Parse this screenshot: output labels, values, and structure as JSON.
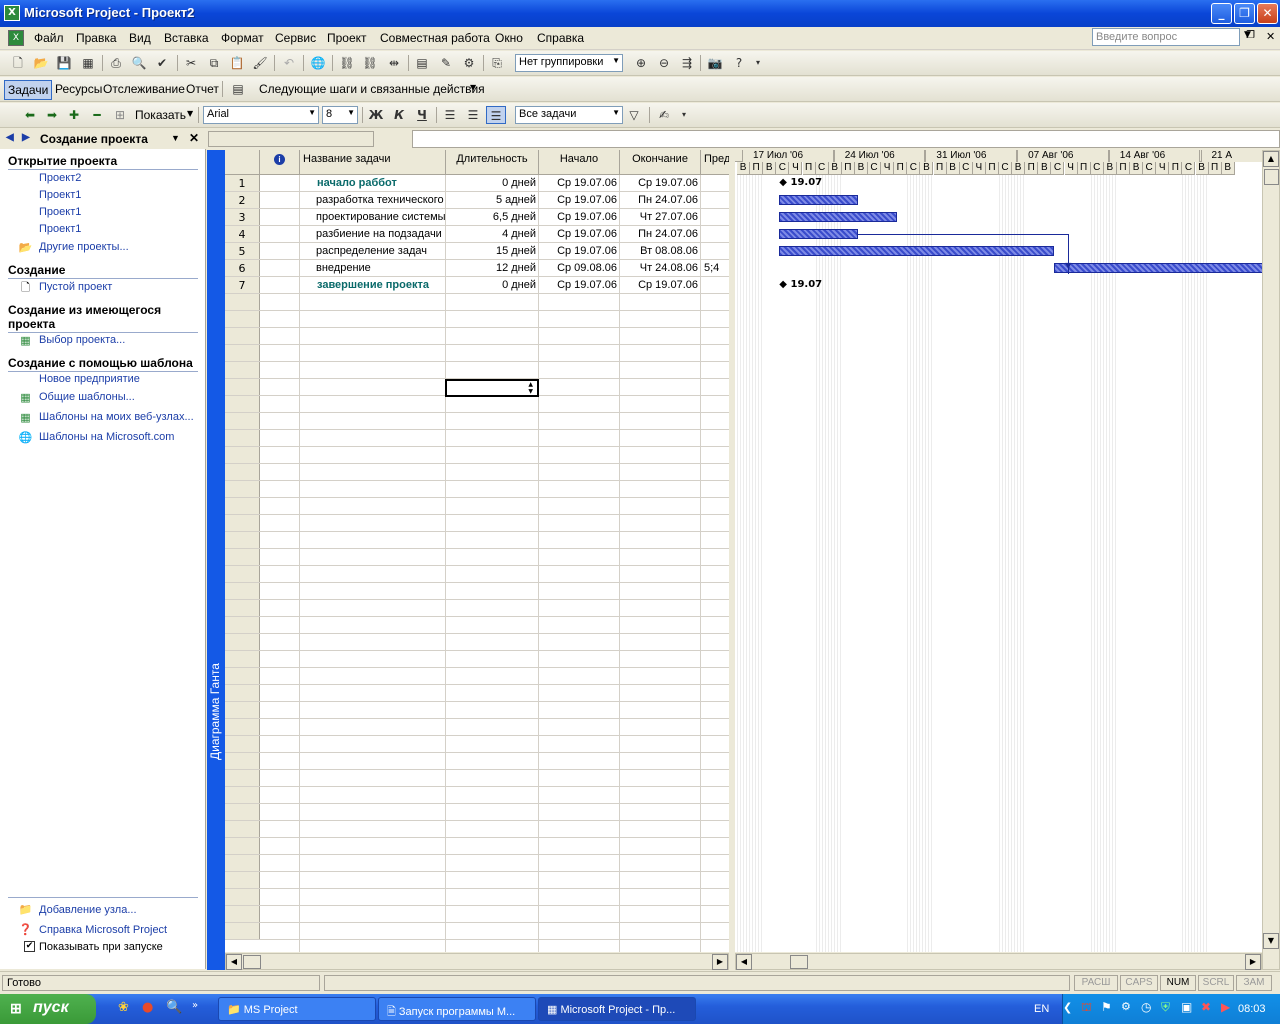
{
  "window": {
    "title": "Microsoft Project - Проект2",
    "app_icon": "X"
  },
  "menu": {
    "items": [
      "Файл",
      "Правка",
      "Вид",
      "Вставка",
      "Формат",
      "Сервис",
      "Проект",
      "Совместная работа",
      "Окно",
      "Справка"
    ],
    "ask_placeholder": "Введите вопрос"
  },
  "toolbar_standard": {
    "grouping": "Нет группировки"
  },
  "toolbar_guide": {
    "tabs": [
      "Задачи",
      "Ресурсы",
      "Отслеживание",
      "Отчет"
    ],
    "next_steps": "Следующие шаги и связанные действия"
  },
  "toolbar_format": {
    "show_label": "Показать",
    "font": "Arial",
    "size": "8",
    "bold": "Ж",
    "italic": "К",
    "underline": "Ч",
    "filter": "Все задачи"
  },
  "taskpane": {
    "title": "Создание проекта",
    "sections": {
      "open": {
        "title": "Открытие проекта",
        "links": [
          "Проект2",
          "Проект1",
          "Проект1",
          "Проект1"
        ],
        "other": "Другие проекты..."
      },
      "create": {
        "title": "Создание",
        "blank": "Пустой проект"
      },
      "existing": {
        "title": "Создание из имеющегося проекта",
        "choose": "Выбор проекта..."
      },
      "template": {
        "title": "Создание с помощью шаблона",
        "links": [
          "Новое предприятие",
          "Общие шаблоны...",
          "Шаблоны на моих веб-узлах...",
          "Шаблоны на Microsoft.com"
        ]
      }
    },
    "footer": {
      "add_node": "Добавление узла...",
      "help": "Справка Microsoft Project",
      "show_startup": "Показывать при запуске"
    }
  },
  "view_label": "Диаграмма Ганта",
  "table": {
    "headers": [
      "Название задачи",
      "Длительность",
      "Начало",
      "Окончание",
      "Пред"
    ],
    "info_icon": "i",
    "rows": [
      {
        "id": "1",
        "name": "начало раббот",
        "duration": "0 дней",
        "start": "Ср 19.07.06",
        "finish": "Ср 19.07.06",
        "pred": "",
        "summary": true
      },
      {
        "id": "2",
        "name": "разработка технического",
        "duration": "5 адней",
        "start": "Ср 19.07.06",
        "finish": "Пн 24.07.06",
        "pred": "",
        "summary": false
      },
      {
        "id": "3",
        "name": "проектирование системы",
        "duration": "6,5 дней",
        "start": "Ср 19.07.06",
        "finish": "Чт 27.07.06",
        "pred": "",
        "summary": false
      },
      {
        "id": "4",
        "name": "разбиение на подзадачи",
        "duration": "4 дней",
        "start": "Ср 19.07.06",
        "finish": "Пн 24.07.06",
        "pred": "",
        "summary": false
      },
      {
        "id": "5",
        "name": "распределение задач",
        "duration": "15 дней",
        "start": "Ср 19.07.06",
        "finish": "Вт 08.08.06",
        "pred": "",
        "summary": false
      },
      {
        "id": "6",
        "name": "внедрение",
        "duration": "12 дней",
        "start": "Ср 09.08.06",
        "finish": "Чт 24.08.06",
        "pred": "5;4",
        "summary": false
      },
      {
        "id": "7",
        "name": "завершение проекта",
        "duration": "0 дней",
        "start": "Ср 19.07.06",
        "finish": "Ср 19.07.06",
        "pred": "",
        "summary": true
      }
    ]
  },
  "gantt": {
    "weeks": [
      "17 Июл '06",
      "24 Июл '06",
      "31 Июл '06",
      "07 Авг '06",
      "14 Авг '06",
      "21 А"
    ],
    "days": [
      "В",
      "П",
      "В",
      "С",
      "Ч",
      "П",
      "С",
      "В",
      "П",
      "В",
      "С",
      "Ч",
      "П",
      "С",
      "В",
      "П",
      "В",
      "С",
      "Ч",
      "П",
      "С",
      "В",
      "П",
      "В",
      "С",
      "Ч",
      "П",
      "С",
      "В",
      "П",
      "В",
      "С",
      "Ч",
      "П",
      "С",
      "В",
      "П",
      "В"
    ],
    "milestone_label": "19.07"
  },
  "status": {
    "text": "Готово",
    "keys": [
      "РАСШ",
      "CAPS",
      "NUM",
      "SCRL",
      "ЗАМ"
    ]
  },
  "taskbar": {
    "start": "пуск",
    "tasks": [
      "MS Project",
      "Запуск программы М...",
      "Microsoft Project - Пр..."
    ],
    "lang": "EN",
    "clock": "08:03"
  }
}
